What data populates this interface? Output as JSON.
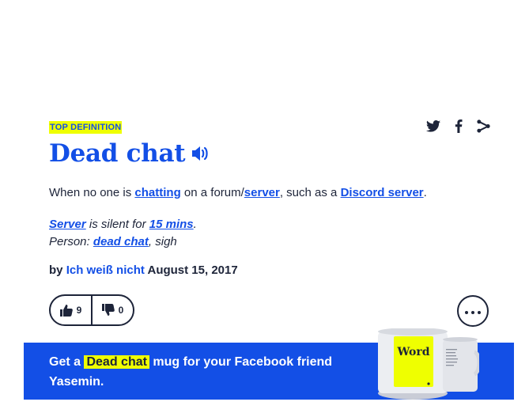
{
  "badge": "TOP DEFINITION",
  "word": "Dead chat",
  "meaning": {
    "p1": "When no one is ",
    "l1": "chatting",
    "p2": " on a forum/",
    "l2": "server",
    "p3": ", such as a ",
    "l3": "Discord server",
    "p4": "."
  },
  "example": {
    "l1": "Server",
    "p1": " is silent for ",
    "l2": "15 mins",
    "p2": ".",
    "p3": "Person: ",
    "l3": "dead chat",
    "p4": ", sigh"
  },
  "contributor": {
    "by": "by ",
    "author": "Ich weiß nicht",
    "date": " August 15, 2017"
  },
  "votes": {
    "up": "9",
    "down": "0"
  },
  "banner": {
    "pre": "Get a ",
    "word": "Dead chat",
    "post": " mug for your Facebook friend Yasemin."
  },
  "mug": {
    "label": "Word"
  },
  "icons": [
    "twitter-icon",
    "facebook-icon",
    "share-icon",
    "speaker-icon",
    "thumbs-up-icon",
    "thumbs-down-icon",
    "more-icon"
  ],
  "colors": {
    "accent": "#134fe6",
    "highlight": "#efff00",
    "text": "#1d2439"
  }
}
